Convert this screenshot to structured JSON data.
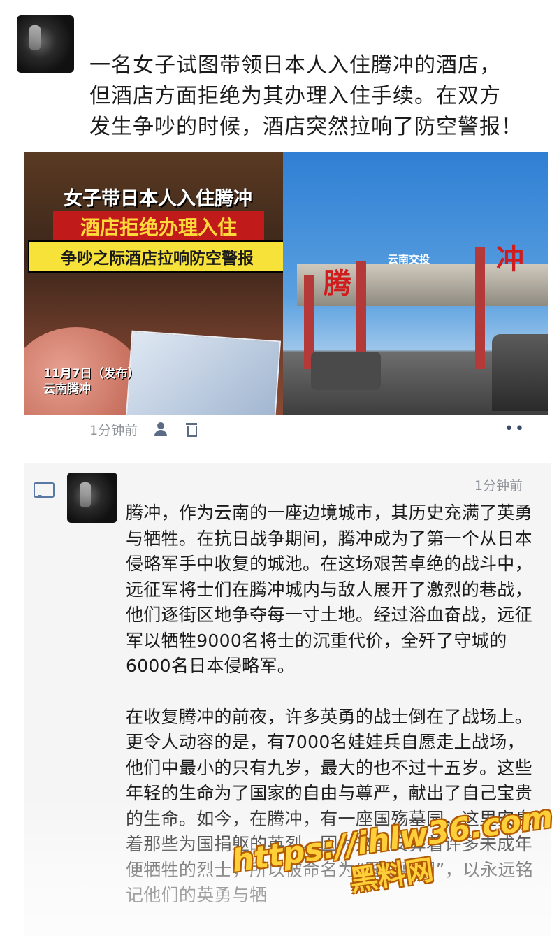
{
  "post": {
    "text_lines": [
      "一名女子试图带领日本人入住腾冲的酒店，",
      "但酒店方面拒绝为其办理入住手续。在双方",
      "发生争吵的时候，酒店突然拉响了防空警报！"
    ],
    "image_left": {
      "caption_line1": "女子带日本人入住腾冲",
      "caption_line2": "酒店拒绝办理入住",
      "caption_line3": "争吵之际酒店拉响防空警报",
      "date_line1": "11月7日（发布）",
      "date_line2": "云南腾冲"
    },
    "image_right": {
      "char_left": "腾",
      "char_right": "冲",
      "sign": "云南交投"
    },
    "time": "1分钟前",
    "icons": [
      "person-icon",
      "trash-icon",
      "more-dots-icon"
    ]
  },
  "comment": {
    "time": "1分钟前",
    "paragraphs": [
      "腾冲，作为云南的一座边境城市，其历史充满了英勇与牺牲。在抗日战争期间，腾冲成为了第一个从日本侵略军手中收复的城池。在这场艰苦卓绝的战斗中，远征军将士们在腾冲城内与敌人展开了激烈的巷战，他们逐街区地争夺每一寸土地。经过浴血奋战，远征军以牺牲9000名将士的沉重代价，全歼了守城的6000名日本侵略军。",
      "在收复腾冲的前夜，许多英勇的战士倒在了战场上。更令人动容的是，有7000名娃娃兵自愿走上战场，他们中最小的只有九岁，最大的也不过十五岁。这些年轻的生命为了国家的自由与尊严，献出了自己宝贵的生命。如今，在腾冲，有一座国殇墓园，这里安息着那些为国捐躯的英烈。因为这里安葬着许多未成年便牺牲的烈士，所以被命名为“国殇墓园”，以永远铭记他们的英勇与牺"
    ]
  },
  "watermark": {
    "url": "https://ihlw36.com",
    "name": "黑料网"
  }
}
